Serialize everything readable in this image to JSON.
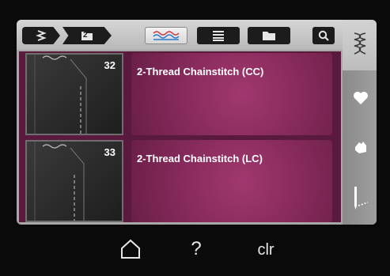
{
  "toolbar": {
    "crumb_folder_number": "2"
  },
  "stitches": [
    {
      "number": "32",
      "name": "2-Thread Chainstitch (CC)"
    },
    {
      "number": "33",
      "name": "2-Thread Chainstitch (LC)"
    }
  ],
  "bottom_nav": {
    "help_label": "?",
    "clear_label": "clr"
  },
  "icons": {
    "crumb1": "stitch-menu-icon",
    "crumb2": "folder-icon",
    "stitch_tab": "stitch-wave-icon",
    "list_tab": "list-icon",
    "folder_tab": "folder-icon",
    "search": "search-icon",
    "side_stitches": "stitch-pattern-icon",
    "side_favorite": "heart-icon",
    "side_personal": "hand-icon",
    "side_needle": "needle-icon",
    "home": "home-icon"
  },
  "colors": {
    "accent_magenta": "#8a2c5e",
    "toolbar_gray": "#c8c8c8",
    "button_dark": "#1c1c1c"
  }
}
